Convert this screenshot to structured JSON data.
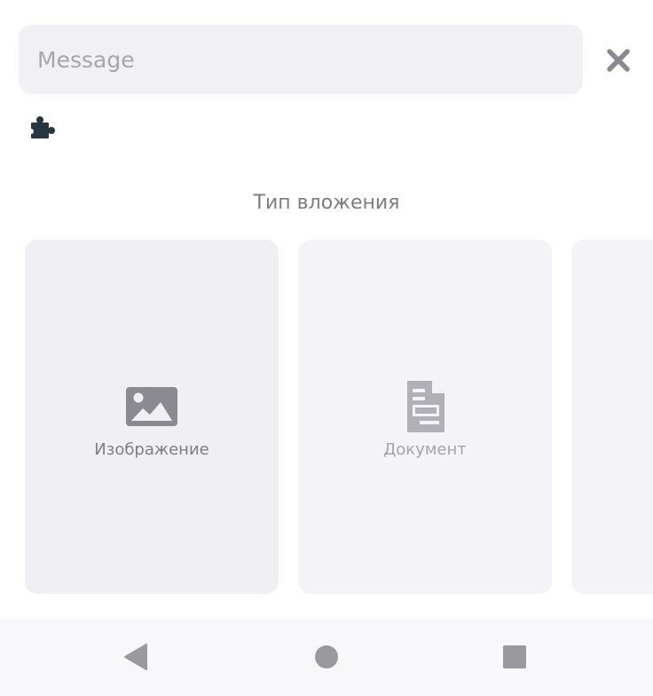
{
  "composer": {
    "message_placeholder": "Message",
    "message_value": "",
    "close_icon": "close-icon",
    "plugin_icon": "puzzle-piece-icon"
  },
  "attachments": {
    "title": "Тип вложения",
    "types": [
      {
        "label": "Изображение",
        "icon": "image-icon"
      },
      {
        "label": "Документ",
        "icon": "document-icon"
      }
    ]
  },
  "navbar": {
    "back_icon": "back-triangle-icon",
    "home_icon": "home-circle-icon",
    "recents_icon": "recents-square-icon"
  },
  "colors": {
    "icon_gray": "#8a8a90",
    "plugin_icon": "#27373f",
    "nav_icon": "#9a9a9e",
    "input_bg": "#f1f1f5",
    "card_bg": "#efeff4"
  }
}
